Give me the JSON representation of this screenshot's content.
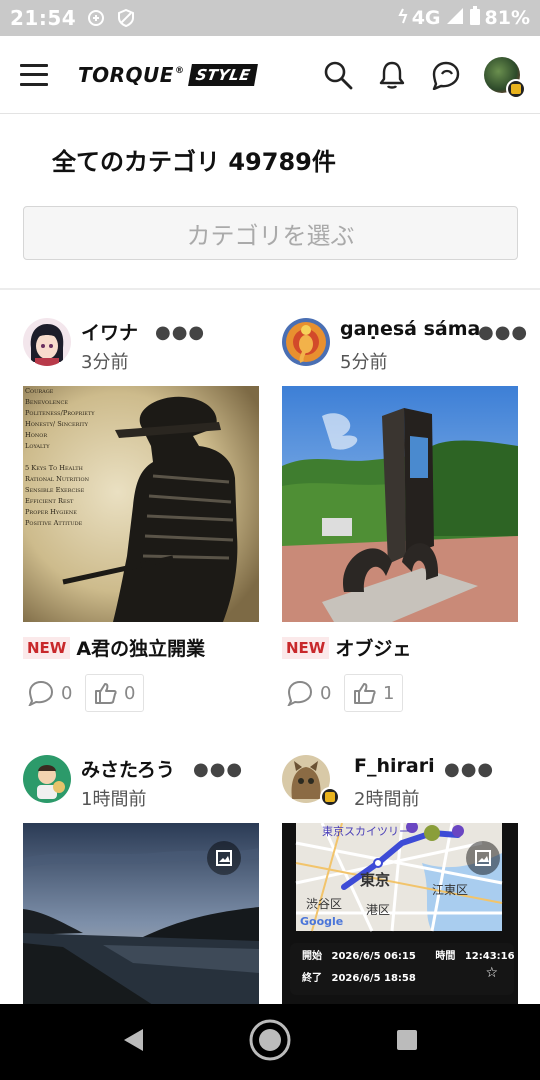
{
  "status_bar": {
    "time": "21:54",
    "network": "4G",
    "battery": "81%"
  },
  "header": {
    "logo_main": "TORQUE",
    "logo_reg": "®",
    "logo_box": "STYLE",
    "icons": [
      "hamburger-menu",
      "search",
      "bell",
      "chat",
      "avatar"
    ]
  },
  "category": {
    "title": "全てのカテゴリ 49789件",
    "select_placeholder": "カテゴリを選ぶ"
  },
  "posts": [
    {
      "user": "イワナ",
      "time": "3分前",
      "new_label": "NEW",
      "title": "A君の独立開業",
      "comments": "0",
      "likes": "0",
      "image_text": "Courage\nBenevolence\nPoliteness/Propriety\nHonesty/ Sincerity\nHonor\nLoyalty\n\n5 Keys To Health\nRational Nutrition\nSensible Exercise\nEfficient Rest\nProper Hygiene\nPositive Attitude"
    },
    {
      "user": "gaṇesá sáma",
      "time": "5分前",
      "new_label": "NEW",
      "title": "オブジェ",
      "comments": "0",
      "likes": "1"
    },
    {
      "user": "みさたろう",
      "time": "1時間前"
    },
    {
      "user": "F_hirari",
      "time": "2時間前",
      "map": {
        "labels": [
          "東京スカイツリー",
          "東京",
          "江東区",
          "渋谷区",
          "港区",
          "Google"
        ],
        "start_label": "開始",
        "start_value": "2026/6/5 06:15",
        "duration_label": "時間",
        "duration_value": "12:43:16",
        "end_label": "終了",
        "end_value": "2026/6/5 18:58"
      }
    }
  ]
}
